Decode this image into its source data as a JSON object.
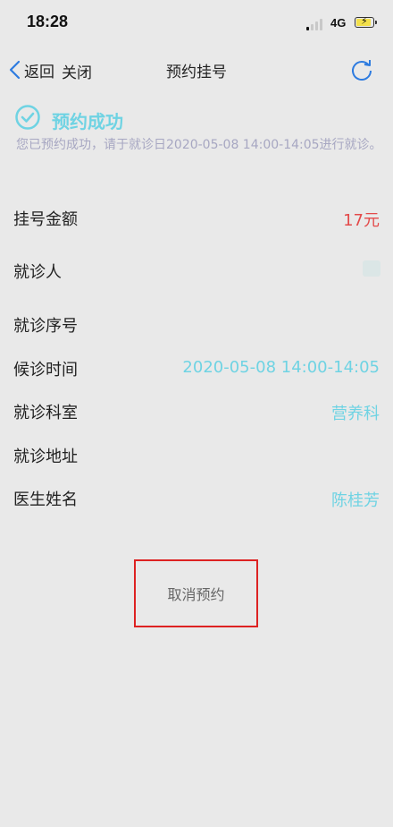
{
  "status_bar": {
    "time": "18:28",
    "network": "4G",
    "battery_level": 0.8
  },
  "nav": {
    "back_label": "返回",
    "close_label": "关闭",
    "title": "预约挂号",
    "icons": {
      "back": "chevron-left-icon",
      "refresh": "refresh-icon"
    }
  },
  "success": {
    "title": "预约成功",
    "description": "您已预约成功，请于就诊日2020-05-08 14:00-14:05进行就诊。",
    "icon": "check-circle-icon"
  },
  "details": [
    {
      "label": "挂号金额",
      "value": "17元"
    },
    {
      "label": "就诊人",
      "value": ""
    },
    {
      "label": "就诊序号",
      "value": ""
    },
    {
      "label": "候诊时间",
      "value": "2020-05-08 14:00-14:05"
    },
    {
      "label": "就诊科室",
      "value": "营养科"
    },
    {
      "label": "就诊地址",
      "value": ""
    },
    {
      "label": "医生姓名",
      "value": "陈桂芳"
    }
  ],
  "actions": {
    "cancel_label": "取消预约"
  },
  "colors": {
    "accent": "#6fd3e3",
    "price": "#e34a4a",
    "background": "#e9e9e9",
    "highlight_border": "#dd2222"
  }
}
